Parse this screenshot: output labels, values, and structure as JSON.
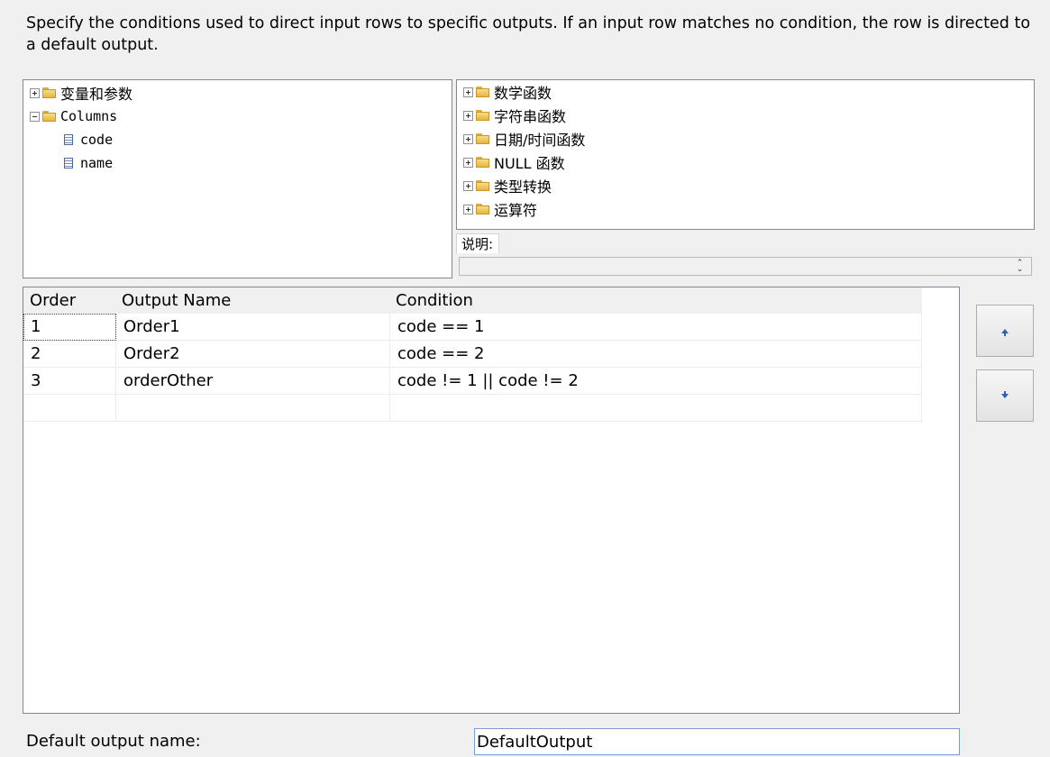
{
  "description": "Specify the conditions used to direct input rows to specific outputs. If an input row matches no condition, the row is directed to a default output.",
  "left_tree": {
    "items": [
      {
        "label": "变量和参数",
        "expander": "plus"
      },
      {
        "label": "Columns",
        "expander": "minus"
      },
      {
        "label": "code"
      },
      {
        "label": "name"
      }
    ]
  },
  "right_tree": {
    "items": [
      {
        "label": "数学函数"
      },
      {
        "label": "字符串函数"
      },
      {
        "label": "日期/时间函数"
      },
      {
        "label": "NULL 函数"
      },
      {
        "label": "类型转换"
      },
      {
        "label": "运算符"
      }
    ]
  },
  "description_panel": {
    "label": "说明:",
    "value": ""
  },
  "grid": {
    "headers": [
      "Order",
      "Output Name",
      "Condition"
    ],
    "rows": [
      [
        "1",
        "Order1",
        "code == 1"
      ],
      [
        "2",
        "Order2",
        "code == 2"
      ],
      [
        "3",
        "orderOther",
        "code != 1 || code != 2"
      ]
    ]
  },
  "move_buttons": {
    "up_icon": "arrow-up-icon",
    "down_icon": "arrow-down-icon"
  },
  "default_output": {
    "label": "Default output name:",
    "value": "DefaultOutput"
  },
  "colors": {
    "window_bg": "#f0f0f0",
    "panel_border": "#828790",
    "input_focus_border": "#7a9cd3",
    "arrow": "#2c5fb8",
    "folder": "#e6b540"
  }
}
